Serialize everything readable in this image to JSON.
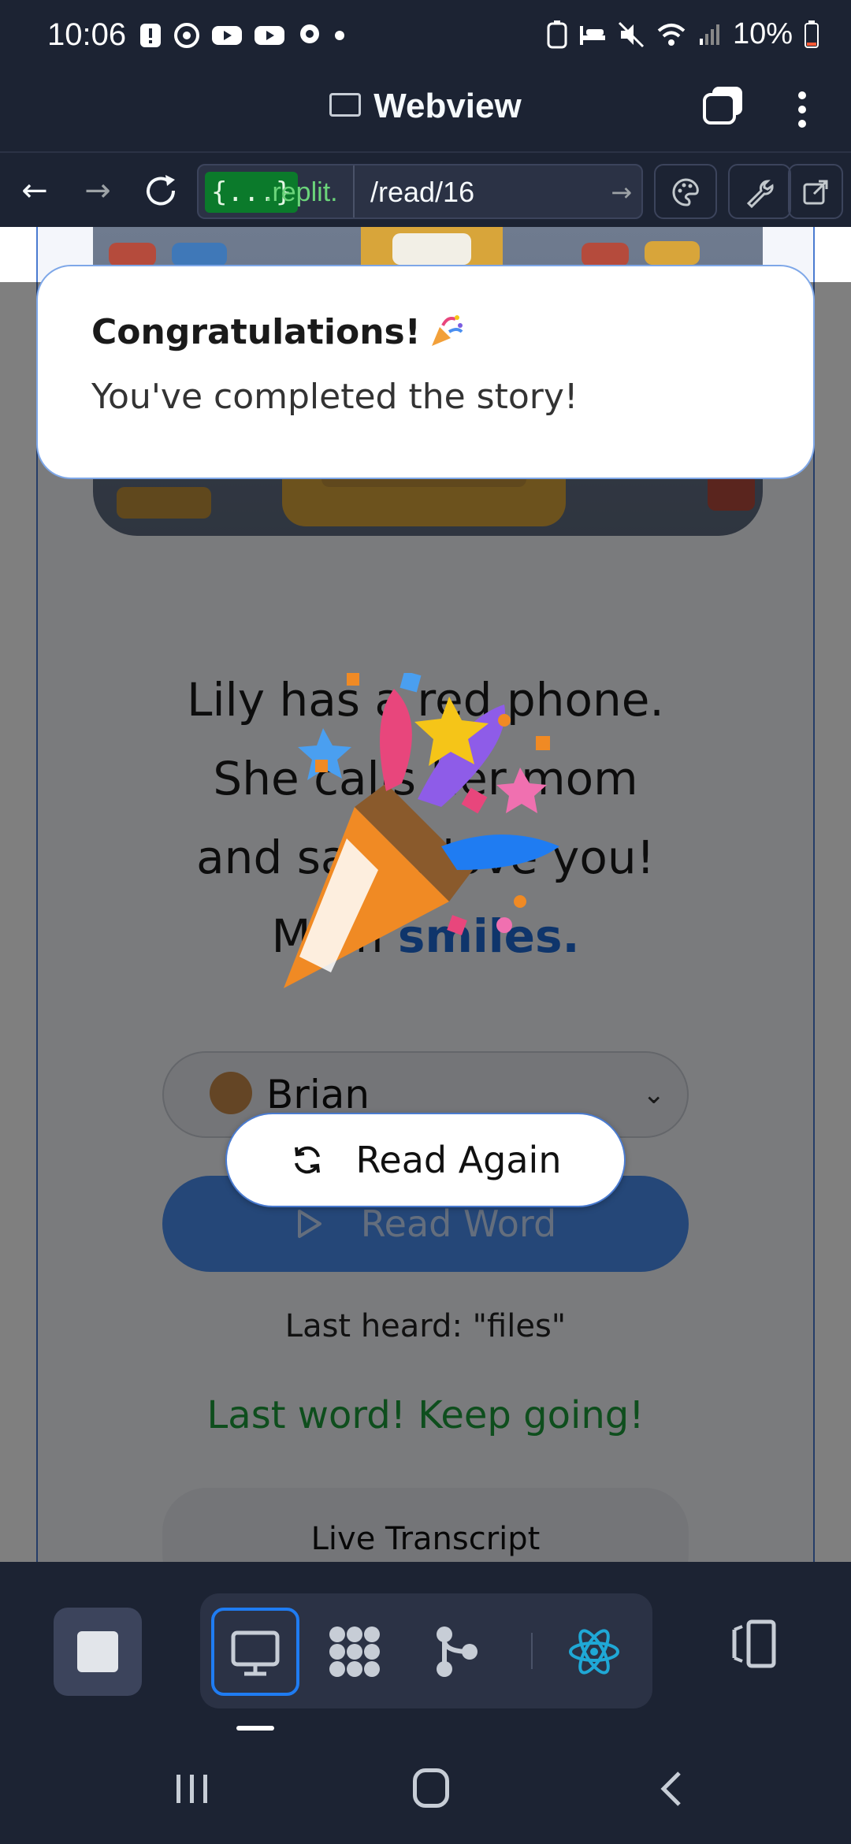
{
  "status_bar": {
    "time": "10:06",
    "battery": "10%"
  },
  "header": {
    "title": "Webview"
  },
  "url_bar": {
    "chip": "{...}",
    "domain": ".replit.",
    "path": "/read/16"
  },
  "toast": {
    "title": "Congratulations!",
    "message": "You've completed the story!"
  },
  "story": {
    "line1": "Lily has a red phone.",
    "line2": "She calls her mom",
    "line3": "and says I love you!",
    "line4_prefix": "Mom ",
    "line4_highlight": "smiles."
  },
  "voice": {
    "selected": "Brian"
  },
  "buttons": {
    "read_again": "Read Again",
    "read_word": "Read Word"
  },
  "status": {
    "last_heard": "Last heard: \"files\"",
    "encouragement": "Last word! Keep going!"
  },
  "transcript": {
    "label": "Live Transcript"
  },
  "icons": {
    "back": "arrow-left-icon",
    "forward": "arrow-right-icon",
    "reload": "reload-icon",
    "palette": "palette-icon",
    "wrench": "wrench-icon",
    "external": "external-link-icon"
  },
  "colors": {
    "replit_bg": "#1c2333",
    "accent_blue": "#1f7cf2",
    "success_green": "#1d9c3a",
    "highlight_blue": "#1f6bd6"
  }
}
